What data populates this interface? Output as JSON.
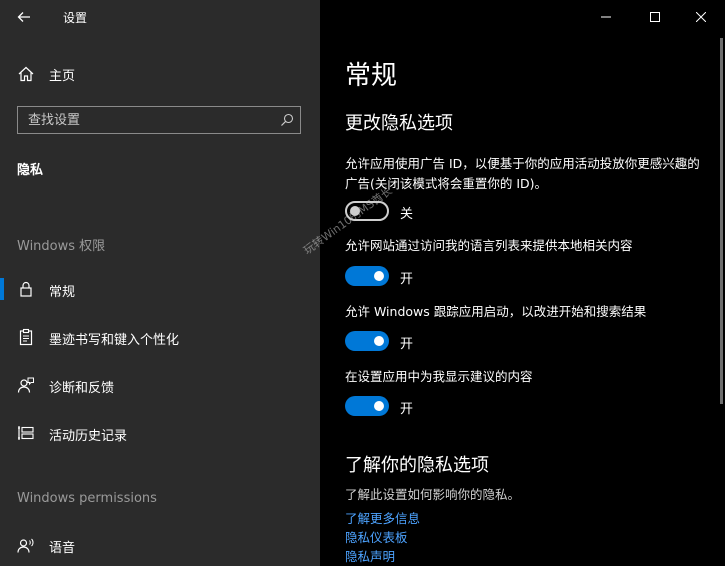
{
  "window": {
    "title": "设置",
    "controls": [
      "minimize-icon",
      "maximize-icon",
      "close-icon"
    ]
  },
  "sidebar": {
    "home_label": "主页",
    "search_placeholder": "查找设置",
    "section_title": "隐私",
    "group_windows_permissions_cn": "Windows 权限",
    "items": [
      {
        "label": "常规",
        "icon": "lock-icon",
        "selected": true
      },
      {
        "label": "墨迹书写和键入个性化",
        "icon": "clipboard-icon",
        "selected": false
      },
      {
        "label": "诊断和反馈",
        "icon": "feedback-person-icon",
        "selected": false
      },
      {
        "label": "活动历史记录",
        "icon": "timeline-icon",
        "selected": false
      }
    ],
    "group_windows_permissions_en": "Windows permissions",
    "items2": [
      {
        "label": "语音",
        "icon": "speech-person-icon",
        "selected": false
      }
    ]
  },
  "main": {
    "page_title": "常规",
    "privacy_title": "更改隐私选项",
    "settings": [
      {
        "description": "允许应用使用广告 ID，以便基于你的应用活动投放你更感兴趣的广告(关闭该模式将会重置你的 ID)。",
        "state": "关",
        "on": false
      },
      {
        "description": "允许网站通过访问我的语言列表来提供本地相关内容",
        "state": "开",
        "on": true
      },
      {
        "description": "允许 Windows 跟踪应用启动，以改进开始和搜索结果",
        "state": "开",
        "on": true
      },
      {
        "description": "在设置应用中为我显示建议的内容",
        "state": "开",
        "on": true
      }
    ],
    "learn_title": "了解你的隐私选项",
    "learn_desc": "了解此设置如何影响你的隐私。",
    "links": [
      "了解更多信息",
      "隐私仪表板",
      "隐私声明"
    ]
  },
  "watermark": "玩转Win10的MS酋长",
  "colors": {
    "accent": "#0078d7",
    "link": "#4da3ff",
    "sidebar_bg": "#2b2b2b",
    "main_bg": "#000000"
  }
}
